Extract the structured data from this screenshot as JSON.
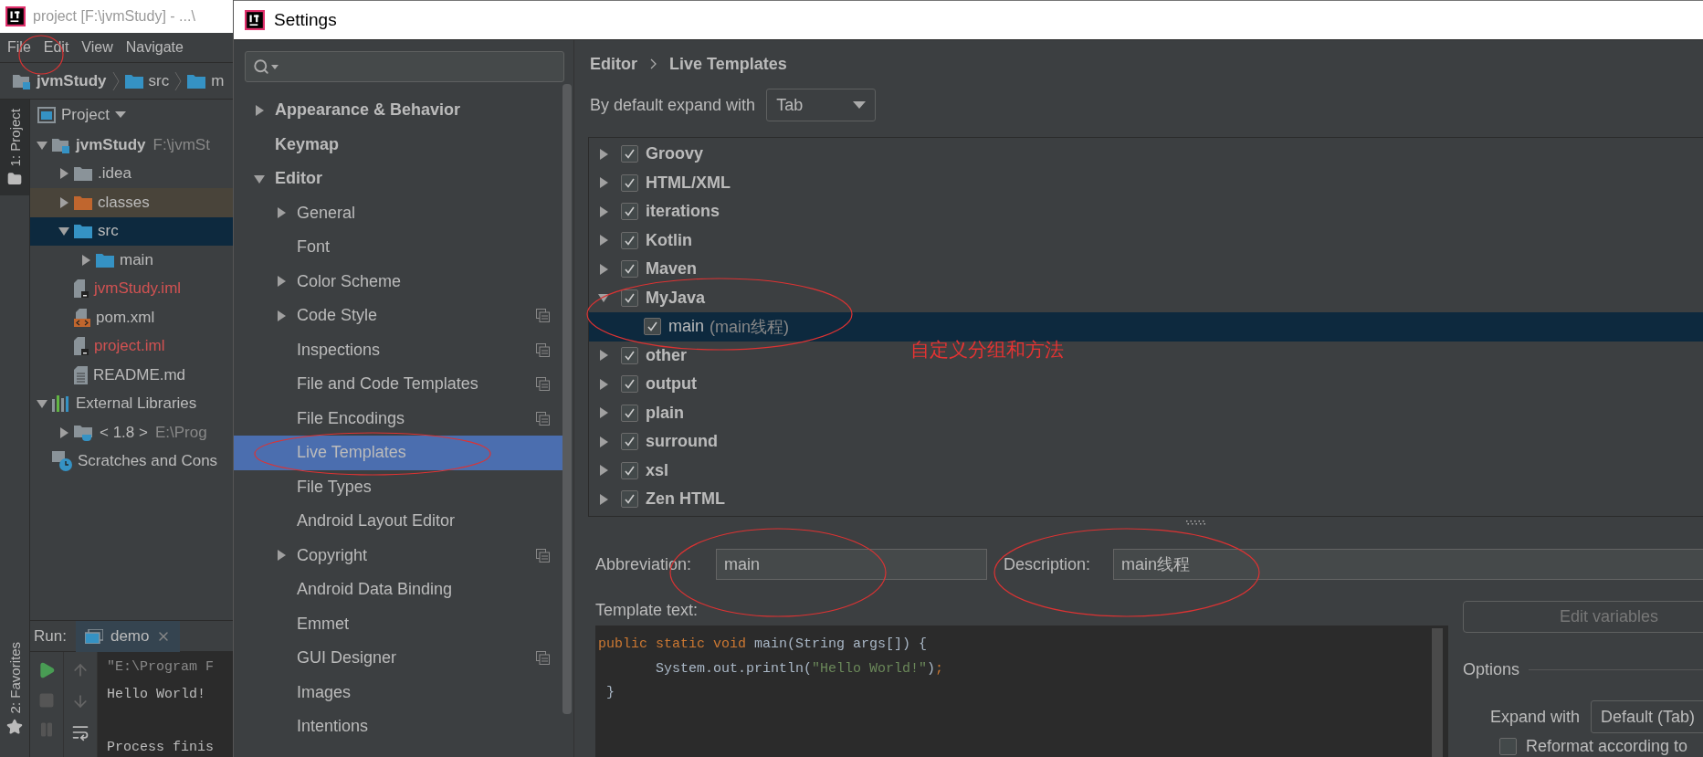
{
  "ide": {
    "title": "project [F:\\jvmStudy] - ...\\",
    "menu": [
      "File",
      "Edit",
      "View",
      "Navigate"
    ],
    "breadcrumb": [
      "jvmStudy",
      "src",
      "m"
    ],
    "tool_stripe": {
      "top": "1: Project",
      "bottom": "2: Favorites"
    },
    "project_panel": {
      "title": "Project",
      "tree": [
        {
          "label": "jvmStudy",
          "detail": "F:\\jvmSt",
          "kind": "module",
          "expanded": true,
          "selected": false,
          "children": [
            {
              "label": ".idea",
              "kind": "folder",
              "expanded": false,
              "selected": false
            },
            {
              "label": "classes",
              "kind": "excluded",
              "expanded": false,
              "selected": false
            },
            {
              "label": "src",
              "kind": "source",
              "expanded": true,
              "selected": true,
              "children": [
                {
                  "label": "main",
                  "kind": "source",
                  "expanded": false,
                  "selected": false
                }
              ]
            },
            {
              "label": "jvmStudy.iml",
              "kind": "iml",
              "unversioned": true,
              "selected": false
            },
            {
              "label": "pom.xml",
              "kind": "xml",
              "unversioned": false,
              "selected": false
            },
            {
              "label": "project.iml",
              "kind": "iml",
              "unversioned": true,
              "selected": false
            },
            {
              "label": "README.md",
              "kind": "text",
              "unversioned": false,
              "selected": false
            }
          ]
        },
        {
          "label": "External Libraries",
          "kind": "libraries",
          "expanded": true,
          "selected": false,
          "children": [
            {
              "label": "< 1.8 >",
              "detail": "E:\\Prog",
              "kind": "jdk",
              "expanded": false,
              "selected": false
            }
          ]
        },
        {
          "label": "Scratches and Cons",
          "kind": "scratches",
          "selected": false
        }
      ]
    },
    "run_panel": {
      "label": "Run:",
      "tab": "demo",
      "console": [
        {
          "kind": "command",
          "text": "\"E:\\Program F"
        },
        {
          "kind": "output",
          "text": "Hello World!"
        },
        {
          "kind": "status",
          "text": "Process finis"
        }
      ]
    }
  },
  "settings": {
    "title": "Settings",
    "nav": [
      {
        "label": "Appearance & Behavior",
        "expanded": false,
        "selected": false
      },
      {
        "label": "Keymap",
        "selected": false
      },
      {
        "label": "Editor",
        "expanded": true,
        "selected": false,
        "children": [
          {
            "label": "General",
            "expanded": false,
            "selected": false
          },
          {
            "label": "Font",
            "selected": false
          },
          {
            "label": "Color Scheme",
            "expanded": false,
            "selected": false
          },
          {
            "label": "Code Style",
            "expanded": false,
            "project_scope": true,
            "selected": false
          },
          {
            "label": "Inspections",
            "project_scope": true,
            "selected": false
          },
          {
            "label": "File and Code Templates",
            "project_scope": true,
            "selected": false
          },
          {
            "label": "File Encodings",
            "project_scope": true,
            "selected": false
          },
          {
            "label": "Live Templates",
            "selected": true
          },
          {
            "label": "File Types",
            "selected": false
          },
          {
            "label": "Android Layout Editor",
            "selected": false
          },
          {
            "label": "Copyright",
            "expanded": false,
            "project_scope": true,
            "selected": false
          },
          {
            "label": "Android Data Binding",
            "selected": false
          },
          {
            "label": "Emmet",
            "selected": false
          },
          {
            "label": "GUI Designer",
            "project_scope": true,
            "selected": false
          },
          {
            "label": "Images",
            "selected": false
          },
          {
            "label": "Intentions",
            "selected": false
          }
        ]
      }
    ],
    "breadcrumb": [
      "Editor",
      "Live Templates"
    ],
    "expand_default": {
      "label": "By default expand with",
      "value": "Tab"
    },
    "template_groups": [
      {
        "name": "Groovy",
        "checked": true,
        "expanded": false,
        "selected": false
      },
      {
        "name": "HTML/XML",
        "checked": true,
        "expanded": false,
        "selected": false
      },
      {
        "name": "iterations",
        "checked": true,
        "expanded": false,
        "selected": false
      },
      {
        "name": "Kotlin",
        "checked": true,
        "expanded": false,
        "selected": false
      },
      {
        "name": "Maven",
        "checked": true,
        "expanded": false,
        "selected": false
      },
      {
        "name": "MyJava",
        "checked": true,
        "expanded": true,
        "selected": false,
        "children": [
          {
            "name": "main",
            "description": "(main线程)",
            "checked": true,
            "selected": true
          }
        ]
      },
      {
        "name": "other",
        "checked": true,
        "expanded": false,
        "selected": false
      },
      {
        "name": "output",
        "checked": true,
        "expanded": false,
        "selected": false
      },
      {
        "name": "plain",
        "checked": true,
        "expanded": false,
        "selected": false
      },
      {
        "name": "surround",
        "checked": true,
        "expanded": false,
        "selected": false
      },
      {
        "name": "xsl",
        "checked": true,
        "expanded": false,
        "selected": false
      },
      {
        "name": "Zen HTML",
        "checked": true,
        "expanded": false,
        "selected": false
      }
    ],
    "annotation": "自定义分组和方法",
    "abbreviation": {
      "label": "Abbreviation:",
      "value": "main"
    },
    "description": {
      "label": "Description:",
      "value": "main线程"
    },
    "template_text": {
      "label": "Template text:",
      "lines": [
        [
          {
            "kind": "keyword",
            "text": "public static void"
          },
          {
            "kind": "plain",
            "text": " main(String args[]) {"
          }
        ],
        [
          {
            "kind": "plain",
            "text": "       System.out.println("
          },
          {
            "kind": "string",
            "text": "\"Hello World!\""
          },
          {
            "kind": "plain",
            "text": ")"
          },
          {
            "kind": "keyword",
            "text": ";"
          }
        ],
        [
          {
            "kind": "plain",
            "text": " }"
          }
        ]
      ]
    },
    "edit_variables": {
      "label": "Edit variables",
      "disabled": true
    },
    "options": {
      "title": "Options",
      "expand_with": {
        "label": "Expand with",
        "value": "Default (Tab)"
      },
      "reformat": {
        "label": "Reformat according to",
        "checked": false
      }
    }
  }
}
